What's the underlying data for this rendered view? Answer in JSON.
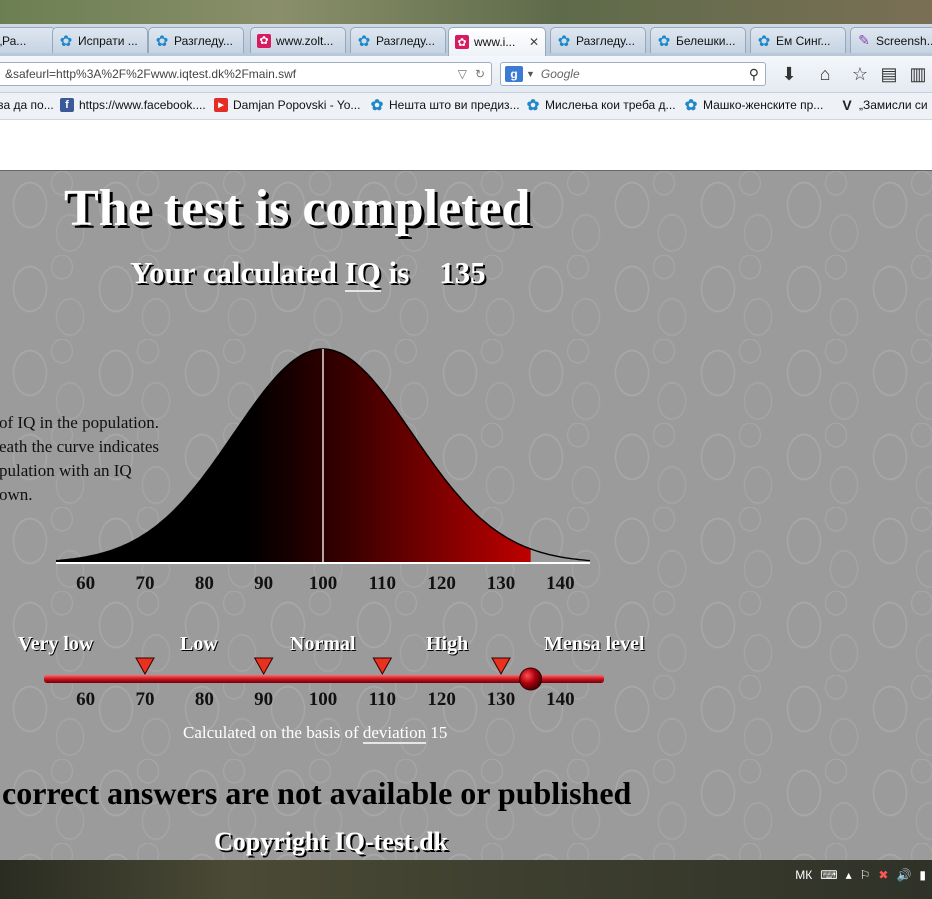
{
  "tabs": [
    {
      "label": "С „Ра...",
      "icon": "pink-square"
    },
    {
      "label": "Испрати ...",
      "icon": "blue-flower"
    },
    {
      "label": "Разгледу...",
      "icon": "blue-flower"
    },
    {
      "label": "www.zolt...",
      "icon": "pink-square"
    },
    {
      "label": "Разгледу...",
      "icon": "blue-flower"
    },
    {
      "label": "www.i...",
      "icon": "pink-square",
      "active": true
    },
    {
      "label": "Разгледу...",
      "icon": "blue-flower"
    },
    {
      "label": "Белешки...",
      "icon": "blue-flower"
    },
    {
      "label": "Ем Синг...",
      "icon": "blue-flower"
    },
    {
      "label": "Screensh...",
      "icon": "purple-feather"
    }
  ],
  "navbar": {
    "url": "&safeurl=http%3A%2F%2Fwww.iqtest.dk%2Fmain.swf",
    "search_placeholder": "Google",
    "search_engine_letter": "g"
  },
  "bookmarks": [
    {
      "label": "за да по...",
      "icon": "none"
    },
    {
      "label": "https://www.facebook....",
      "icon": "facebook-icon",
      "letter": "f"
    },
    {
      "label": "Damjan Popovski - Yo...",
      "icon": "youtube-icon",
      "letter": "▶"
    },
    {
      "label": "Нешта што ви предиз...",
      "icon": "blue-flower"
    },
    {
      "label": "Мислења кои треба д...",
      "icon": "blue-flower"
    },
    {
      "label": "Машко-женските пр...",
      "icon": "blue-flower"
    },
    {
      "label": "„Замисли си",
      "icon": "vice-icon",
      "letter": "V"
    }
  ],
  "page": {
    "title": "The test is completed",
    "result_prefix": "Your calculated",
    "result_iq": "IQ",
    "result_is": "is",
    "result_value": "135",
    "description_lines": [
      "of IQ in the population.",
      "eath the curve indicates",
      "pulation with an IQ",
      "own."
    ],
    "scale_categories": [
      "Very low",
      "Low",
      "Normal",
      "High",
      "Mensa level"
    ],
    "caption_prefix": "Calculated on the basis of",
    "caption_link": "deviation",
    "caption_value": "15",
    "notice": "correct answers are not available or published",
    "copyright": "Copyright IQ-test.dk"
  },
  "chart_data": {
    "type": "area",
    "title": "",
    "x_ticks": [
      60,
      70,
      80,
      90,
      100,
      110,
      120,
      130,
      140
    ],
    "xlim": [
      55,
      145
    ],
    "mean": 100,
    "deviation": 15,
    "result": 135,
    "markers": [
      70,
      90,
      110,
      130
    ],
    "slider_ticks": [
      60,
      70,
      80,
      90,
      100,
      110,
      120,
      130,
      140
    ]
  },
  "taskbar": {
    "language": "МК"
  },
  "colors": {
    "background": "#9b9b9b",
    "curve_dark": "#000000",
    "curve_red": "#e00000",
    "slider": "#c8141e"
  }
}
